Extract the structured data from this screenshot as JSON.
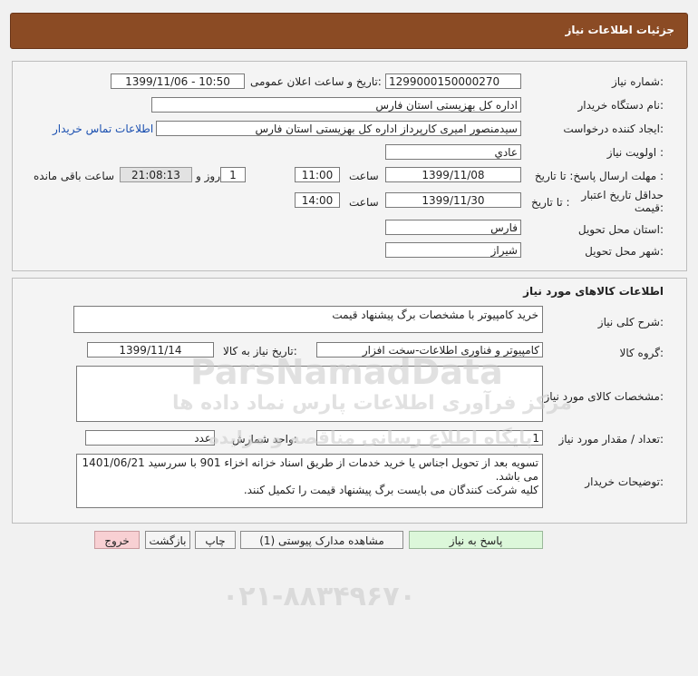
{
  "header": {
    "title": "جزئیات اطلاعات نیاز"
  },
  "need_info": {
    "need_number_label": "شماره نیاز:",
    "need_number": "1299000150000270",
    "announce_label": "تاریخ و ساعت اعلان عمومی:",
    "announce_value": "1399/11/06 - 10:50",
    "buyer_org_label": "نام دستگاه خریدار:",
    "buyer_org": "اداره کل بهزیستی استان فارس",
    "creator_label": "ایجاد کننده درخواست:",
    "creator": "سیدمنصور امیری کارپرداز اداره کل بهزیستی استان فارس",
    "contact_link": "اطلاعات تماس خریدار",
    "priority_label": "اولویت نیاز :",
    "priority": "عادي",
    "deadline_label": "مهلت ارسال پاسخ: تا تاریخ :",
    "deadline_date": "1399/11/08",
    "time_label": "ساعت",
    "deadline_time": "11:00",
    "days_value": "1",
    "days_label": "روز و",
    "remaining_value": "21:08:13",
    "remaining_label": "ساعت باقی مانده",
    "price_validity_label_1": "حداقل تاریخ اعتبار",
    "price_validity_label_2": "قیمت:",
    "price_until_label": "تا تاریخ :",
    "price_date": "1399/11/30",
    "price_time_label": "ساعت",
    "price_time": "14:00",
    "province_label": "استان محل تحویل:",
    "province": "فارس",
    "city_label": "شهر محل تحویل:",
    "city": "شیراز"
  },
  "goods": {
    "section_title": "اطلاعات کالاهای مورد نیاز",
    "description_label": "شرح کلی نیاز:",
    "description": "خرید کامپیوتر با مشخصات برگ پیشنهاد قیمت",
    "group_label": "گروه کالا:",
    "group": "کامپیوتر و فناوری اطلاعات-سخت افزار",
    "need_date_label": "تاریخ نیاز به کالا:",
    "need_date": "1399/11/14",
    "specs_label": "مشخصات کالای مورد نیاز:",
    "specs": "",
    "quantity_label": "تعداد / مقدار مورد نیاز:",
    "quantity": "1",
    "unit_label": "واحد شمارش:",
    "unit": "عدد",
    "notes_label": "توضیحات خریدار:",
    "notes_line1": "تسویه بعد از تحویل اجناس یا خرید خدمات  از طریق اسناد خزانه اخزاء 901 با سررسید  1401/06/21",
    "notes_line2": "می باشد.",
    "notes_line3": "کلیه شرکت کنندگان می بایست برگ پیشنهاد قیمت را تکمیل کنند."
  },
  "buttons": {
    "reply": "پاسخ به نیاز",
    "attachments": "مشاهده مدارک پیوستی (1)",
    "print": "چاپ",
    "back": "بازگشت",
    "exit": "خروج"
  },
  "watermark": {
    "brand": "ParsNamadData",
    "line1": "مرکز فرآوری اطلاعات پارس نماد داده ها",
    "line2": "پایگاه اطلاع رسانی مناقصه و مزایده",
    "phone": "۰۲۱-۸۸۳۴۹۶۷۰"
  },
  "colors": {
    "header_bg": "#8b4b24",
    "reply_bg": "#dcf7da",
    "exit_bg": "#f8d0d3",
    "link": "#1a4fb0"
  }
}
